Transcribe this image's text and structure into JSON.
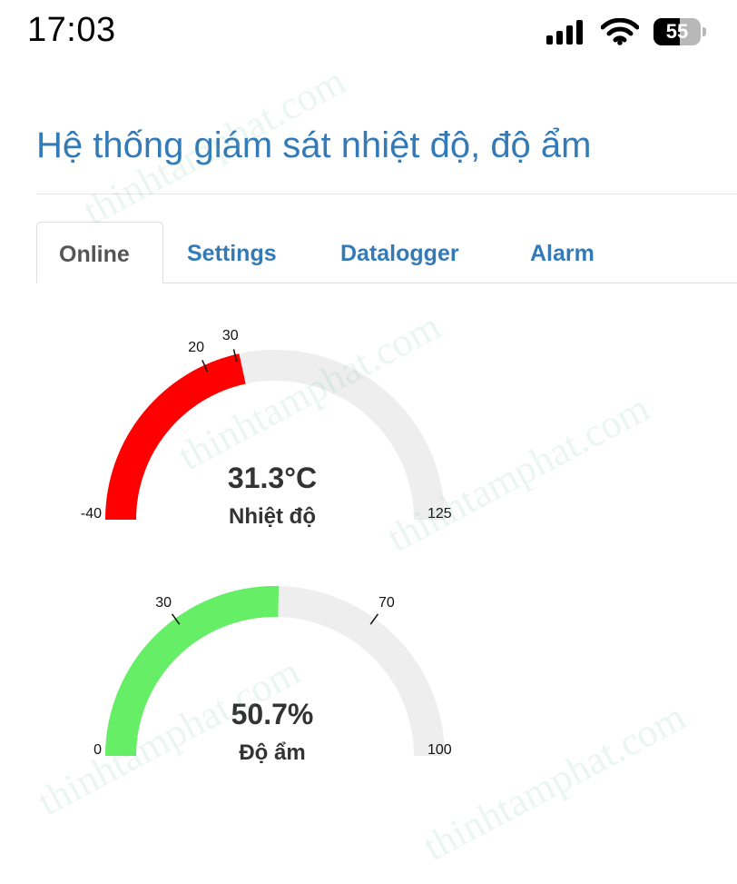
{
  "status_bar": {
    "time": "17:03",
    "battery_level": "55",
    "battery_fraction": 0.55
  },
  "header": {
    "title": "Hệ thống giám sát nhiệt độ, độ ẩm"
  },
  "tabs": [
    {
      "label": "Online",
      "active": true
    },
    {
      "label": "Settings",
      "active": false
    },
    {
      "label": "Datalogger",
      "active": false
    },
    {
      "label": "Alarm",
      "active": false
    }
  ],
  "gauges": {
    "temperature": {
      "value": 31.3,
      "value_text": "31.3°C",
      "label": "Nhiệt độ",
      "min": -40,
      "max": 125,
      "min_label": "-40",
      "max_label": "125",
      "ticks": [
        {
          "value": 20,
          "label": "20"
        },
        {
          "value": 30,
          "label": "30"
        }
      ],
      "fill_color": "#ff0000",
      "track_color": "#eeeeee"
    },
    "humidity": {
      "value": 50.7,
      "value_text": "50.7%",
      "label": "Độ ẩm",
      "min": 0,
      "max": 100,
      "min_label": "0",
      "max_label": "100",
      "ticks": [
        {
          "value": 30,
          "label": "30"
        },
        {
          "value": 70,
          "label": "70"
        }
      ],
      "fill_color": "#66ee66",
      "track_color": "#eeeeee"
    }
  },
  "watermark": {
    "text": "thinhtamphat.com",
    "color": "#6ebea0"
  }
}
